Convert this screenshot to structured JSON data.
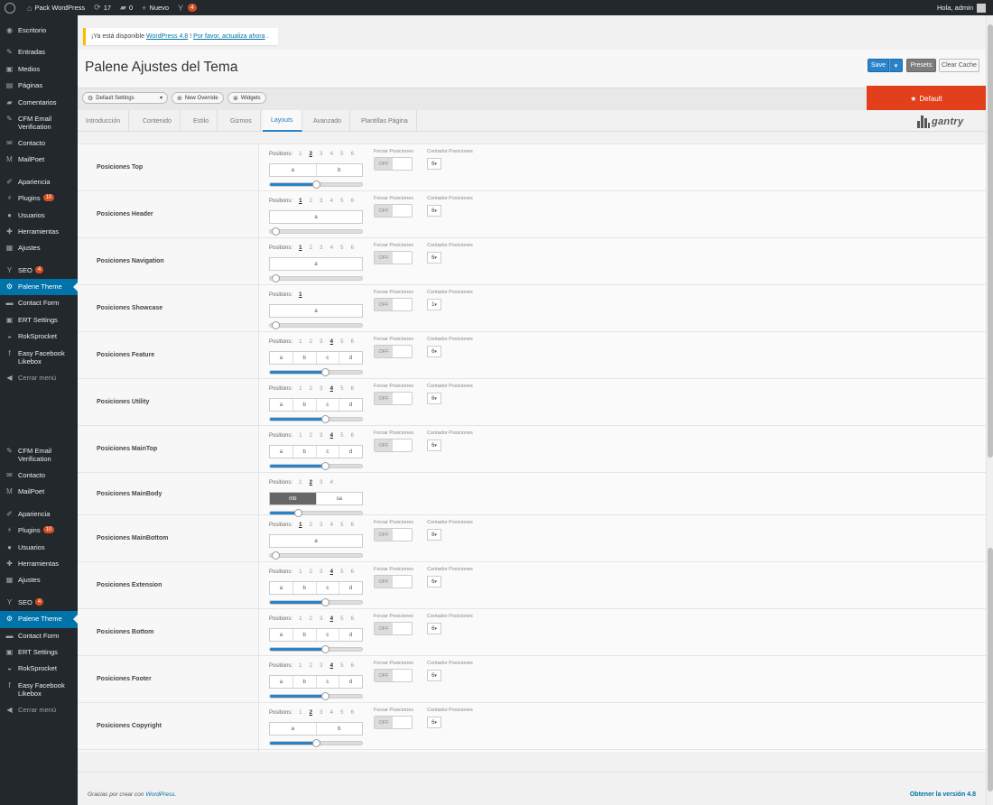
{
  "adminbar": {
    "site_name": "Pack WordPress",
    "updates_count": "17",
    "comments_count": "0",
    "new_label": "Nuevo",
    "seo_badge": "4",
    "greeting": "Hola, admin"
  },
  "menu_top": [
    {
      "label": "Escritorio",
      "icon": "dashboard-icon",
      "glyph": "◉"
    },
    {
      "sep": true
    },
    {
      "label": "Entradas",
      "icon": "pin-icon",
      "glyph": "✎"
    },
    {
      "label": "Medios",
      "icon": "media-icon",
      "glyph": "▣"
    },
    {
      "label": "Páginas",
      "icon": "pages-icon",
      "glyph": "▤"
    },
    {
      "label": "Comentarios",
      "icon": "comments-icon",
      "glyph": "▰"
    },
    {
      "label": "CFM Email\nVerification",
      "icon": "pin-icon",
      "glyph": "✎",
      "tall": true
    },
    {
      "label": "Contacto",
      "icon": "mail-icon",
      "glyph": "✉"
    },
    {
      "label": "MailPoet",
      "icon": "mailpoet-icon",
      "glyph": "M"
    },
    {
      "sep": true
    },
    {
      "label": "Apariencia",
      "icon": "brush-icon",
      "glyph": "✐"
    },
    {
      "label": "Plugins",
      "icon": "plugin-icon",
      "glyph": "⚡",
      "badge": "10"
    },
    {
      "label": "Usuarios",
      "icon": "users-icon",
      "glyph": "●"
    },
    {
      "label": "Herramientas",
      "icon": "tools-icon",
      "glyph": "✚"
    },
    {
      "label": "Ajustes",
      "icon": "settings-icon",
      "glyph": "▦"
    },
    {
      "sep": true
    },
    {
      "label": "SEO",
      "icon": "seo-icon",
      "glyph": "Y",
      "badge": "4"
    },
    {
      "label": "Palene Theme",
      "icon": "gear-icon",
      "glyph": "⚙",
      "current": true
    },
    {
      "label": "Contact Form",
      "icon": "form-icon",
      "glyph": "▬"
    },
    {
      "label": "ERT Settings",
      "icon": "ert-icon",
      "glyph": "▣"
    },
    {
      "label": "RokSprocket",
      "icon": "rok-icon",
      "glyph": "◒"
    },
    {
      "label": "Easy Facebook\nLikebox",
      "icon": "facebook-icon",
      "glyph": "f",
      "tall": true
    },
    {
      "label": "Cerrar menú",
      "icon": "collapse-icon",
      "glyph": "◀",
      "collapse": true
    }
  ],
  "menu_bottom": [
    {
      "label": "CFM Email\nVerification",
      "icon": "pin-icon",
      "glyph": "✎",
      "tall": true
    },
    {
      "label": "Contacto",
      "icon": "mail-icon",
      "glyph": "✉"
    },
    {
      "label": "MailPoet",
      "icon": "mailpoet-icon",
      "glyph": "M"
    },
    {
      "sep": true
    },
    {
      "label": "Apariencia",
      "icon": "brush-icon",
      "glyph": "✐"
    },
    {
      "label": "Plugins",
      "icon": "plugin-icon",
      "glyph": "⚡",
      "badge": "10"
    },
    {
      "label": "Usuarios",
      "icon": "users-icon",
      "glyph": "●"
    },
    {
      "label": "Herramientas",
      "icon": "tools-icon",
      "glyph": "✚"
    },
    {
      "label": "Ajustes",
      "icon": "settings-icon",
      "glyph": "▦"
    },
    {
      "sep": true
    },
    {
      "label": "SEO",
      "icon": "seo-icon",
      "glyph": "Y",
      "badge": "4"
    },
    {
      "label": "Palene Theme",
      "icon": "gear-icon",
      "glyph": "⚙",
      "current": true
    },
    {
      "label": "Contact Form",
      "icon": "form-icon",
      "glyph": "▬"
    },
    {
      "label": "ERT Settings",
      "icon": "ert-icon",
      "glyph": "▣"
    },
    {
      "label": "RokSprocket",
      "icon": "rok-icon",
      "glyph": "◒"
    },
    {
      "label": "Easy Facebook\nLikebox",
      "icon": "facebook-icon",
      "glyph": "f",
      "tall": true
    },
    {
      "label": "Cerrar menú",
      "icon": "collapse-icon",
      "glyph": "◀",
      "collapse": true
    }
  ],
  "notice": {
    "prefix": "¡Ya está disponible",
    "link1": "WordPress 4.8",
    "link2": "Por favor, actualiza ahora"
  },
  "header": {
    "title": "Palene Ajustes del Tema",
    "save_label": "Save",
    "presets_label": "Presets",
    "clear_cache_label": "Clear Cache"
  },
  "toolbar": {
    "default_settings": "Default Settings",
    "new_override": "New Override",
    "widgets": "Widgets",
    "banner": "Default"
  },
  "tabs": [
    "Introducción",
    "Contenido",
    "Estilo",
    "Gizmos",
    "Layouts",
    "Avanzado",
    "Plantillas Página"
  ],
  "active_tab": "Layouts",
  "logo": {
    "text": "gantry"
  },
  "labels": {
    "positions": "Positions:",
    "force": "Forzar Posiciones",
    "count": "Contador Posiciones",
    "off": "OFF"
  },
  "rows": [
    {
      "label": "Posiciones Top",
      "counts": [
        "1",
        "2",
        "3",
        "4",
        "5",
        "6"
      ],
      "selected": "2",
      "segments": [
        "a",
        "b"
      ],
      "level": 0.5,
      "force": true,
      "count_value": "6"
    },
    {
      "label": "Posiciones Header",
      "counts": [
        "1",
        "2",
        "3",
        "4",
        "5",
        "6"
      ],
      "selected": "1",
      "segments": [
        "a"
      ],
      "level": 0.0,
      "force": true,
      "count_value": "6"
    },
    {
      "label": "Posiciones Navigation",
      "counts": [
        "1",
        "2",
        "3",
        "4",
        "5",
        "6"
      ],
      "selected": "1",
      "segments": [
        "a"
      ],
      "level": 0.0,
      "force": true,
      "count_value": "6"
    },
    {
      "label": "Posiciones Showcase",
      "counts": [
        "1"
      ],
      "selected": "1",
      "segments": [
        "a"
      ],
      "level": 0.0,
      "force": true,
      "count_value": "1"
    },
    {
      "label": "Posiciones Feature",
      "counts": [
        "1",
        "2",
        "3",
        "4",
        "5",
        "6"
      ],
      "selected": "4",
      "segments": [
        "a",
        "b",
        "c",
        "d"
      ],
      "level": 0.6,
      "force": true,
      "count_value": "6"
    },
    {
      "label": "Posiciones Utility",
      "counts": [
        "1",
        "2",
        "3",
        "4",
        "5",
        "6"
      ],
      "selected": "4",
      "segments": [
        "a",
        "b",
        "c",
        "d"
      ],
      "level": 0.6,
      "force": true,
      "count_value": "6"
    },
    {
      "label": "Posiciones MainTop",
      "counts": [
        "1",
        "2",
        "3",
        "4",
        "5",
        "6"
      ],
      "selected": "4",
      "segments": [
        "a",
        "b",
        "c",
        "d"
      ],
      "level": 0.6,
      "force": true,
      "count_value": "6"
    },
    {
      "label": "Posiciones MainBody",
      "counts": [
        "1",
        "2",
        "3",
        "4"
      ],
      "selected": "2",
      "segments": [
        "mb",
        "sa"
      ],
      "dark_first": true,
      "level": 0.3,
      "force": false,
      "count_value": ""
    },
    {
      "label": "Posiciones MainBottom",
      "counts": [
        "1",
        "2",
        "3",
        "4",
        "5",
        "6"
      ],
      "selected": "1",
      "segments": [
        "a"
      ],
      "level": 0.0,
      "force": true,
      "count_value": "6"
    },
    {
      "label": "Posiciones Extension",
      "counts": [
        "1",
        "2",
        "3",
        "4",
        "5",
        "6"
      ],
      "selected": "4",
      "segments": [
        "a",
        "b",
        "c",
        "d"
      ],
      "level": 0.6,
      "force": true,
      "count_value": "6"
    },
    {
      "label": "Posiciones Bottom",
      "counts": [
        "1",
        "2",
        "3",
        "4",
        "5",
        "6"
      ],
      "selected": "4",
      "segments": [
        "a",
        "b",
        "c",
        "d"
      ],
      "level": 0.6,
      "force": true,
      "count_value": "6"
    },
    {
      "label": "Posiciones Footer",
      "counts": [
        "1",
        "2",
        "3",
        "4",
        "5",
        "6"
      ],
      "selected": "4",
      "segments": [
        "a",
        "b",
        "c",
        "d"
      ],
      "level": 0.6,
      "force": true,
      "count_value": "6"
    },
    {
      "label": "Posiciones Copyright",
      "counts": [
        "1",
        "2",
        "3",
        "4",
        "5",
        "6"
      ],
      "selected": "2",
      "segments": [
        "a",
        "b"
      ],
      "level": 0.5,
      "force": true,
      "count_value": "6"
    }
  ],
  "footer": {
    "thanks_prefix": "Gracias por crear con",
    "thanks_link": "WordPress",
    "version_link": "Obtener la versión 4.8"
  },
  "colors": {
    "accent": "#2a82c8",
    "banner": "#e2401c",
    "admin_dark": "#23282d",
    "current_menu": "#0073aa"
  }
}
